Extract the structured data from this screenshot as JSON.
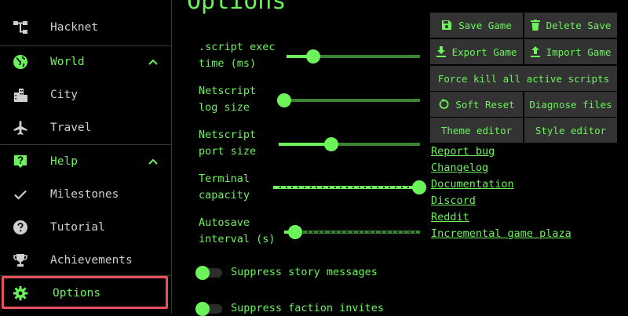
{
  "sidebar": {
    "items": [
      {
        "label": "Hacknet",
        "icon": "network-tree-icon"
      },
      {
        "label": "World",
        "icon": "globe-icon",
        "expandable": true
      },
      {
        "label": "City",
        "icon": "city-icon"
      },
      {
        "label": "Travel",
        "icon": "airplane-icon"
      },
      {
        "label": "Help",
        "icon": "help-box-icon",
        "expandable": true
      },
      {
        "label": "Milestones",
        "icon": "checkmark-icon"
      },
      {
        "label": "Tutorial",
        "icon": "question-circle-icon"
      },
      {
        "label": "Achievements",
        "icon": "trophy-icon"
      },
      {
        "label": "Options",
        "icon": "gear-icon",
        "selected": true
      }
    ]
  },
  "main": {
    "title": "Options",
    "sliders": [
      {
        "label": ".script exec\ntime (ms)",
        "fraction": 0.2
      },
      {
        "label": "Netscript\nlog size",
        "fraction": 0.05
      },
      {
        "label": "Netscript\nport size",
        "fraction": 0.37
      },
      {
        "label": "Terminal\ncapacity",
        "fraction": 1.0
      },
      {
        "label": "Autosave\ninterval (s)",
        "fraction": 0.08
      }
    ],
    "toggles": [
      {
        "label": "Suppress story messages",
        "on": true
      },
      {
        "label": "Suppress faction invites",
        "on": true
      }
    ]
  },
  "buttons": {
    "save_game": "Save Game",
    "delete_save": "Delete Save",
    "export_game": "Export Game",
    "import_game": "Import Game",
    "force_kill": "Force kill all active scripts",
    "soft_reset": "Soft Reset",
    "diagnose_files": "Diagnose files",
    "theme_editor": "Theme editor",
    "style_editor": "Style editor"
  },
  "links": [
    "Report bug",
    "Changelog",
    "Documentation",
    "Discord",
    "Reddit",
    "Incremental game plaza"
  ],
  "colors": {
    "accent": "#6cf35b",
    "background": "#000000",
    "button_bg": "#333333",
    "selection_outline": "#e8505b",
    "muted_text": "#cfcfcf"
  }
}
